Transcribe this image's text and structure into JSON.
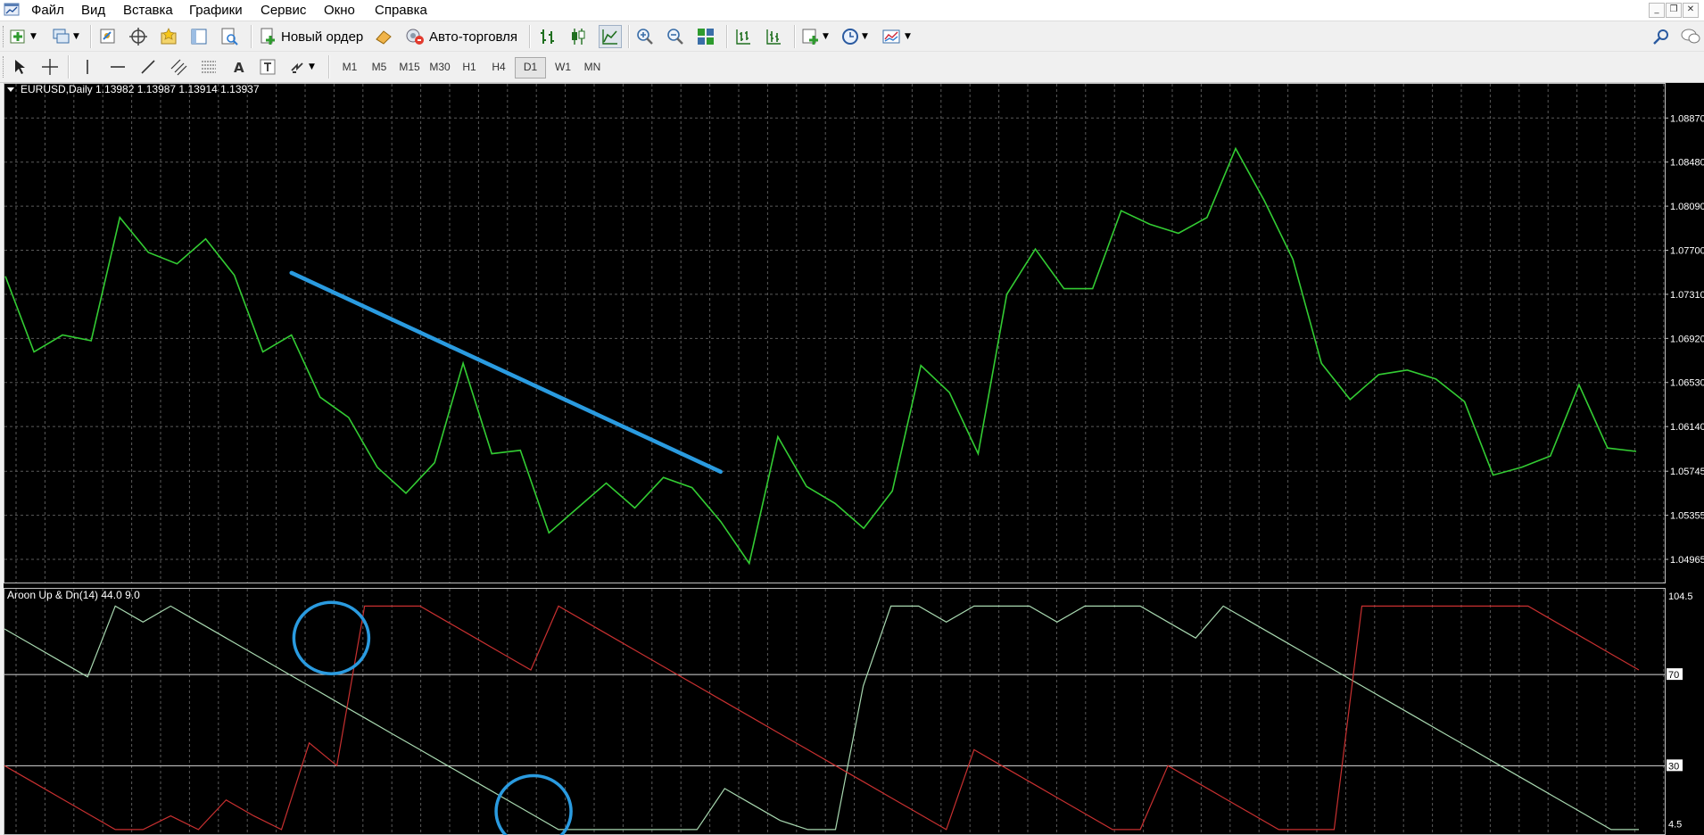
{
  "menu": {
    "items": [
      "Файл",
      "Вид",
      "Вставка",
      "Графики",
      "Сервис",
      "Окно",
      "Справка"
    ]
  },
  "toolbar": {
    "new_order_label": "Новый ордер",
    "auto_trading_label": "Авто-торговля",
    "timeframes": [
      "M1",
      "M5",
      "M15",
      "M30",
      "H1",
      "H4",
      "D1",
      "W1",
      "MN"
    ],
    "active_timeframe": "D1"
  },
  "chart_data": [
    {
      "type": "line",
      "title": "EURUSD,Daily  1.13982 1.13987 1.13914 1.13937",
      "y_ticks": [
        "1.08870",
        "1.08480",
        "1.08090",
        "1.07700",
        "1.07310",
        "1.06920",
        "1.06530",
        "1.06140",
        "1.05745",
        "1.05355",
        "1.04965"
      ],
      "ylim": [
        1.0476,
        1.0918
      ],
      "series": [
        {
          "color": "#33cc33",
          "values": [
            1.0747,
            1.068,
            1.0695,
            1.069,
            1.0799,
            1.0768,
            1.0758,
            1.078,
            1.0748,
            1.068,
            1.0695,
            1.064,
            1.0622,
            1.0578,
            1.0555,
            1.0582,
            1.067,
            1.059,
            1.0593,
            1.052,
            1.0542,
            1.0564,
            1.0542,
            1.0569,
            1.056,
            1.053,
            1.0493,
            1.0605,
            1.0561,
            1.0546,
            1.0524,
            1.0557,
            1.0668,
            1.0644,
            1.059,
            1.0731,
            1.0771,
            1.0736,
            1.0736,
            1.0805,
            1.0793,
            1.0785,
            1.0799,
            1.086,
            1.0814,
            1.0762,
            1.067,
            1.0638,
            1.066,
            1.0664,
            1.0656,
            1.0636,
            1.0571,
            1.0578,
            1.0588,
            1.0651,
            1.0595,
            1.0592
          ]
        }
      ],
      "annotation": {
        "type": "trendline",
        "color": "#2a9be0",
        "from": [
          10,
          1.075
        ],
        "to": [
          25,
          1.0574
        ]
      }
    },
    {
      "type": "line",
      "title": "Aroon Up & Dn(14) 44.0 9.0",
      "y_ticks": [
        "104.5",
        "70",
        "30",
        "4.5"
      ],
      "ylim": [
        0,
        108
      ],
      "levels": [
        70,
        30
      ],
      "series": [
        {
          "color": "#a8d8b0",
          "values": [
            90,
            83,
            76,
            69,
            100,
            93,
            100,
            93,
            86,
            79,
            72,
            65,
            58,
            51,
            44,
            37,
            30,
            23,
            16,
            9,
            2,
            2,
            2,
            2,
            2,
            2,
            20,
            13,
            6,
            2,
            2,
            65,
            100,
            100,
            93,
            100,
            100,
            100,
            93,
            100,
            100,
            100,
            93,
            86,
            100,
            93,
            86,
            79,
            72,
            65,
            58,
            51,
            44,
            37,
            30,
            23,
            16,
            9,
            2,
            2
          ]
        },
        {
          "color": "#c83030",
          "values": [
            30,
            23,
            16,
            9,
            2,
            2,
            8,
            2,
            15,
            8,
            2,
            40,
            30,
            100,
            100,
            100,
            93,
            86,
            79,
            72,
            100,
            93,
            86,
            79,
            72,
            65,
            58,
            51,
            44,
            37,
            30,
            23,
            16,
            9,
            2,
            37,
            30,
            23,
            16,
            9,
            2,
            2,
            30,
            23,
            16,
            9,
            2,
            2,
            2,
            100,
            100,
            100,
            100,
            100,
            100,
            100,
            93,
            86,
            79,
            72
          ]
        }
      ],
      "annotations": [
        {
          "type": "circle",
          "color": "#2a9be0",
          "at": [
            11.8,
            86
          ]
        },
        {
          "type": "circle",
          "color": "#2a9be0",
          "at": [
            19.1,
            10
          ]
        }
      ]
    }
  ]
}
